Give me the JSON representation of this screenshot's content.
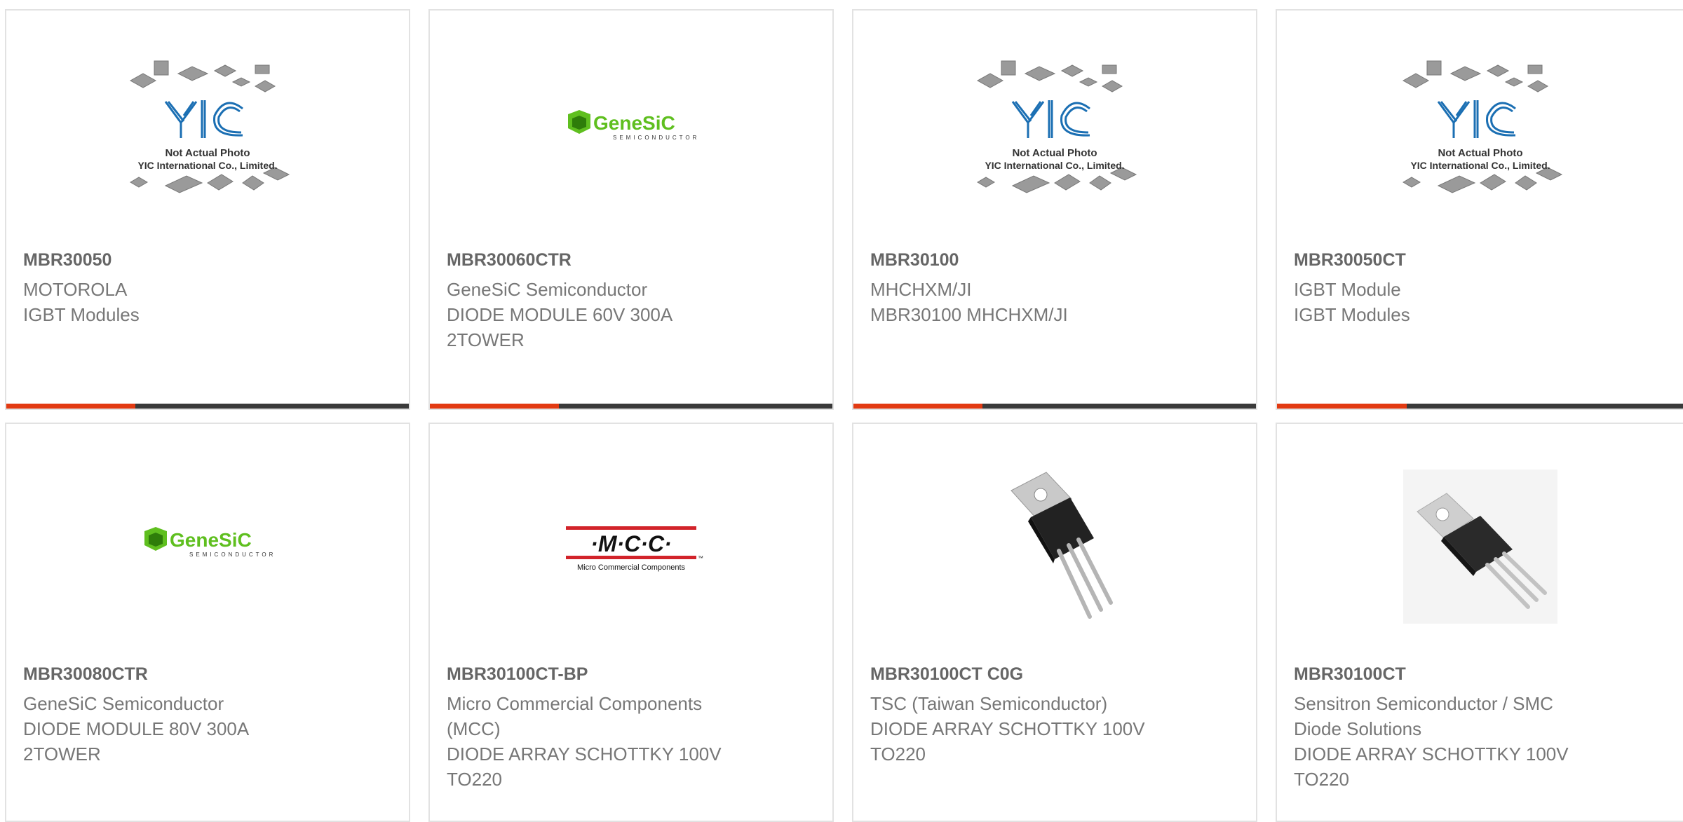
{
  "colors": {
    "accent": "#e23a12",
    "bar": "#3a3a3a",
    "text": "#777777",
    "part_text": "#666666",
    "genesic_green": "#5fbf1f",
    "mcc_red": "#d2232a"
  },
  "placeholder": {
    "line1": "Not Actual Photo",
    "line2": "YIC International Co., Limited.",
    "logo": "YIC"
  },
  "logos": {
    "genesic_name": "GeneSiC",
    "genesic_sub": "SEMICONDUCTOR",
    "mcc_name": "·M·C·C·",
    "mcc_sub": "Micro Commercial Components",
    "mcc_tm": "™"
  },
  "products": [
    {
      "part": "MBR30050",
      "manufacturer": "MOTOROLA",
      "description": "IGBT Modules",
      "image": "yic-placeholder"
    },
    {
      "part": "MBR30060CTR",
      "manufacturer": "GeneSiC Semiconductor",
      "description": "DIODE MODULE 60V 300A 2TOWER",
      "image": "genesic-logo"
    },
    {
      "part": "MBR30100",
      "manufacturer": "MHCHXM/JI",
      "description": "MBR30100 MHCHXM/JI",
      "image": "yic-placeholder"
    },
    {
      "part": "MBR30050CT",
      "manufacturer": "IGBT Module",
      "description": "IGBT Modules",
      "image": "yic-placeholder"
    },
    {
      "part": "MBR30080CTR",
      "manufacturer": "GeneSiC Semiconductor",
      "description": "DIODE MODULE 80V 300A 2TOWER",
      "image": "genesic-logo"
    },
    {
      "part": "MBR30100CT-BP",
      "manufacturer": "Micro Commercial Components (MCC)",
      "description": "DIODE ARRAY SCHOTTKY 100V TO220",
      "image": "mcc-logo"
    },
    {
      "part": "MBR30100CT C0G",
      "manufacturer": "TSC (Taiwan Semiconductor)",
      "description": "DIODE ARRAY SCHOTTKY 100V TO220",
      "image": "to220-photo"
    },
    {
      "part": "MBR30100CT",
      "manufacturer": "Sensitron Semiconductor / SMC Diode Solutions",
      "description": "DIODE ARRAY SCHOTTKY 100V TO220",
      "image": "to220-photo"
    }
  ]
}
